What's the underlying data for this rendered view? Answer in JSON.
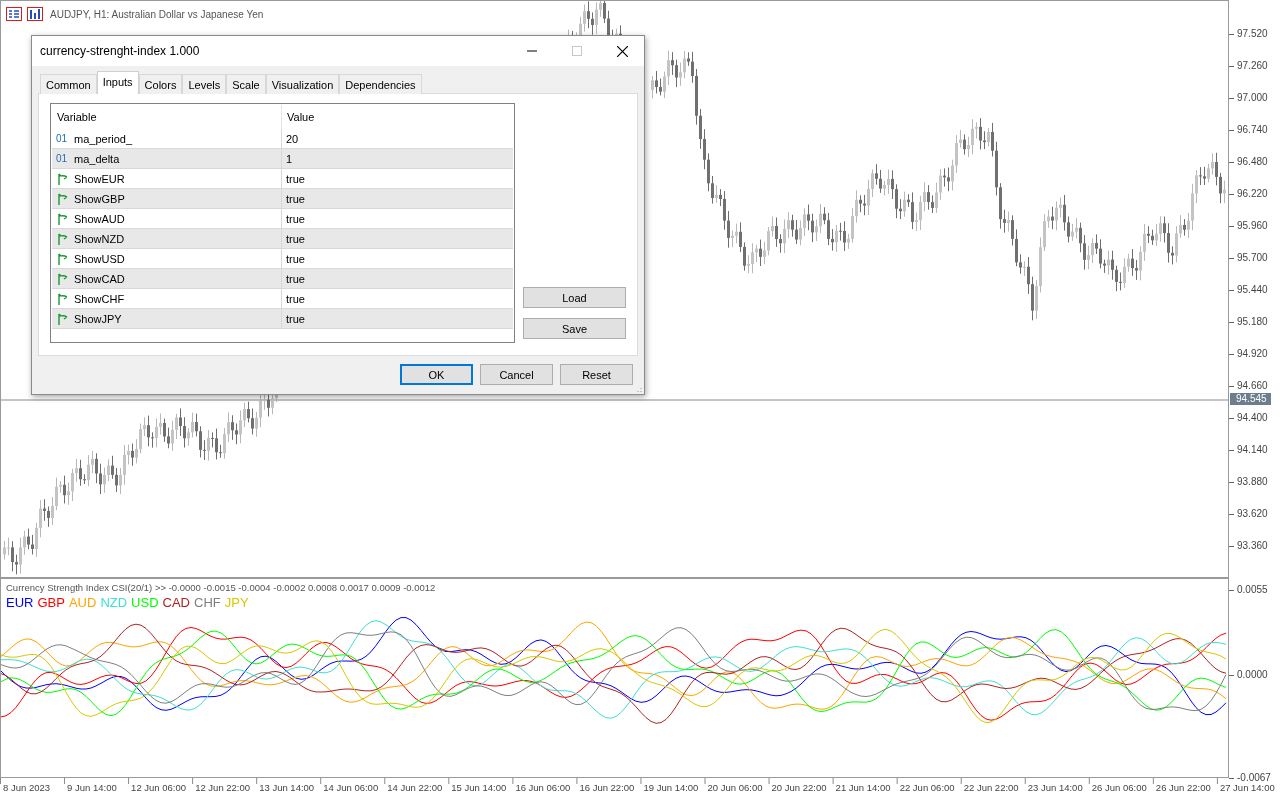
{
  "chart": {
    "title": "AUDJPY, H1:  Australian Dollar vs Japanese Yen",
    "price_ticks": [
      "97.520",
      "97.260",
      "97.000",
      "96.740",
      "96.480",
      "96.220",
      "95.960",
      "95.700",
      "95.440",
      "95.180",
      "94.920",
      "94.660",
      "94.400",
      "94.140",
      "93.880",
      "93.620",
      "93.360"
    ],
    "current_price": "94.545"
  },
  "indicator": {
    "header": "Currency Strength Index CSI(20/1) >> -0.0000 -0.0015 -0.0004 -0.0002 0.0008 0.0017 0.0009 -0.0012",
    "legend": [
      {
        "label": "EUR",
        "color": "#0000ff"
      },
      {
        "label": "GBP",
        "color": "#ff0000"
      },
      {
        "label": "AUD",
        "color": "#ffa500"
      },
      {
        "label": "NZD",
        "color": "#40e0d0"
      },
      {
        "label": "USD",
        "color": "#00ff00"
      },
      {
        "label": "CAD",
        "color": "#b22222"
      },
      {
        "label": "CHF",
        "color": "#808080"
      },
      {
        "label": "JPY",
        "color": "#d8c800"
      }
    ],
    "ticks": [
      "0.0055",
      "0.0000",
      "-0.0067"
    ]
  },
  "time_axis": [
    "8 Jun 2023",
    "9 Jun 14:00",
    "12 Jun 06:00",
    "12 Jun 22:00",
    "13 Jun 14:00",
    "14 Jun 06:00",
    "14 Jun 22:00",
    "15 Jun 14:00",
    "16 Jun 06:00",
    "16 Jun 22:00",
    "19 Jun 14:00",
    "20 Jun 06:00",
    "20 Jun 22:00",
    "21 Jun 14:00",
    "22 Jun 06:00",
    "22 Jun 22:00",
    "23 Jun 14:00",
    "26 Jun 06:00",
    "26 Jun 22:00",
    "27 Jun 14:00"
  ],
  "dialog": {
    "title": "currency-strenght-index 1.000",
    "tabs": [
      {
        "label": "Common",
        "selected": false
      },
      {
        "label": "Inputs",
        "selected": true
      },
      {
        "label": "Colors",
        "selected": false
      },
      {
        "label": "Levels",
        "selected": false
      },
      {
        "label": "Scale",
        "selected": false
      },
      {
        "label": "Visualization",
        "selected": false
      },
      {
        "label": "Dependencies",
        "selected": false
      }
    ],
    "columns": [
      "Variable",
      "Value"
    ],
    "rows": [
      {
        "kind": "int",
        "type_label": "01",
        "variable": "ma_period_",
        "value": "20"
      },
      {
        "kind": "int",
        "type_label": "01",
        "variable": "ma_delta",
        "value": "1"
      },
      {
        "kind": "bool",
        "variable": "ShowEUR",
        "value": "true"
      },
      {
        "kind": "bool",
        "variable": "ShowGBP",
        "value": "true"
      },
      {
        "kind": "bool",
        "variable": "ShowAUD",
        "value": "true"
      },
      {
        "kind": "bool",
        "variable": "ShowNZD",
        "value": "true"
      },
      {
        "kind": "bool",
        "variable": "ShowUSD",
        "value": "true"
      },
      {
        "kind": "bool",
        "variable": "ShowCAD",
        "value": "true"
      },
      {
        "kind": "bool",
        "variable": "ShowCHF",
        "value": "true"
      },
      {
        "kind": "bool",
        "variable": "ShowJPY",
        "value": "true"
      }
    ],
    "side_buttons": [
      "Load",
      "Save"
    ],
    "buttons": [
      {
        "label": "OK",
        "default": true
      },
      {
        "label": "Cancel",
        "default": false
      },
      {
        "label": "Reset",
        "default": false
      }
    ]
  }
}
